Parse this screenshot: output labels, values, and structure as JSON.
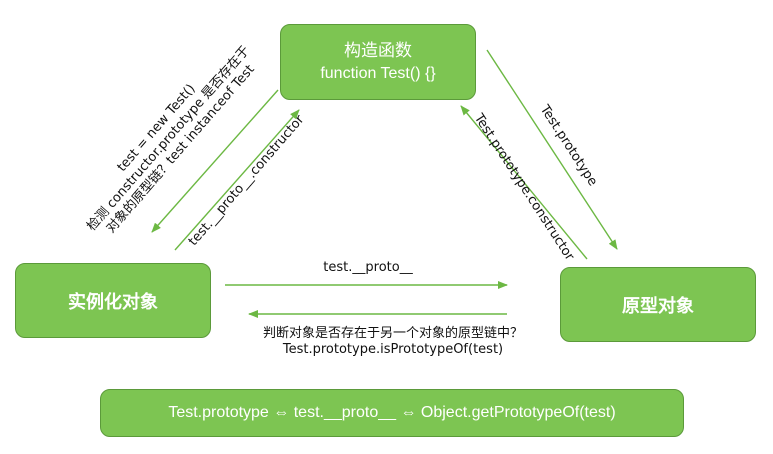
{
  "nodes": {
    "constructor": {
      "line1": "构造函数",
      "line2": "function Test() {}"
    },
    "instance": {
      "label": "实例化对象"
    },
    "prototype": {
      "label": "原型对象"
    },
    "formula": {
      "text": "Test.prototype ⇔ test.__proto__ ⇔ Object.getPrototypeOf(test)"
    }
  },
  "edges": {
    "new_test": {
      "line1": "test = new Test()",
      "line2": "检测 constructor.prototype 是否存在于",
      "line3": "对象的原型链？test instanceof Test"
    },
    "proto_constructor": {
      "label": "test.__proto__.constructor"
    },
    "test_prototype": {
      "label": "Test.prototype"
    },
    "prototype_constructor": {
      "label": "Test.prototype.constructor"
    },
    "instance_proto": {
      "label": "test.__proto__"
    },
    "is_prototype_of": {
      "line1": "判断对象是否存在于另一个对象的原型链中？",
      "line2": "Test.prototype.isPrototypeOf(test)"
    }
  },
  "colors": {
    "box_fill": "#7dc552",
    "box_border": "#5b9a3a",
    "arrow": "#6cb843",
    "text": "#111111"
  }
}
